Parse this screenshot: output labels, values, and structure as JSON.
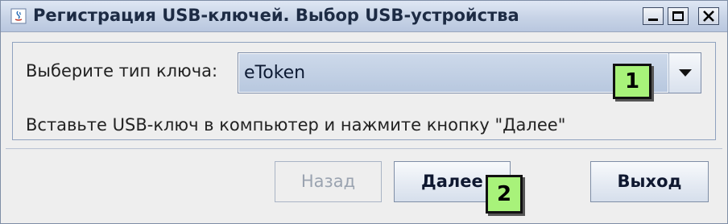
{
  "window": {
    "title": "Регистрация USB-ключей. Выбор USB-устройства",
    "controls": {
      "minimize": "minimize-icon",
      "maximize": "maximize-icon",
      "close": "close-icon"
    }
  },
  "form": {
    "key_type_label": "Выберите тип ключа:",
    "key_type_value": "eToken",
    "hint": "Вставьте USB-ключ в компьютер и нажмите кнопку \"Далее\""
  },
  "buttons": {
    "back": "Назад",
    "next": "Далее",
    "exit": "Выход"
  },
  "annotations": {
    "badge_1": "1",
    "badge_2": "2",
    "color": "#a8f27a"
  },
  "colors": {
    "titlebar": "#c7d3e6",
    "selection": "#c2d1e6",
    "window_bg": "#eeeeee"
  }
}
